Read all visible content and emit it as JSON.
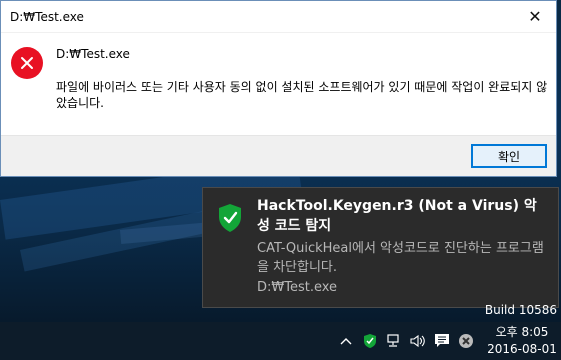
{
  "dialog": {
    "title": "D:₩Test.exe",
    "close_glyph": "✕",
    "message_title": "D:₩Test.exe",
    "message_body": "파일에 바이러스 또는 기타 사용자 동의 없이 설치된 소프트웨어가 있기 때문에 작업이 완료되지 않았습니다.",
    "ok_label": "확인",
    "error_icon": "error-x-icon"
  },
  "toast": {
    "title": "HackTool.Keygen.r3 (Not a Virus) 악성 코드 탐지",
    "body": "CAT-QuickHeal에서 악성코드로 진단하는 프로그램을 차단합니다.",
    "file": "D:₩Test.exe",
    "icon": "shield-check-icon",
    "accent": "#13a538"
  },
  "desktop": {
    "build": "Build 10586"
  },
  "taskbar": {
    "tray_icons": [
      "chevron-up-icon",
      "shield-icon",
      "network-icon",
      "volume-icon",
      "notification-icon",
      "quickheal-icon"
    ],
    "time": "오후 8:05",
    "date": "2016-08-01"
  }
}
